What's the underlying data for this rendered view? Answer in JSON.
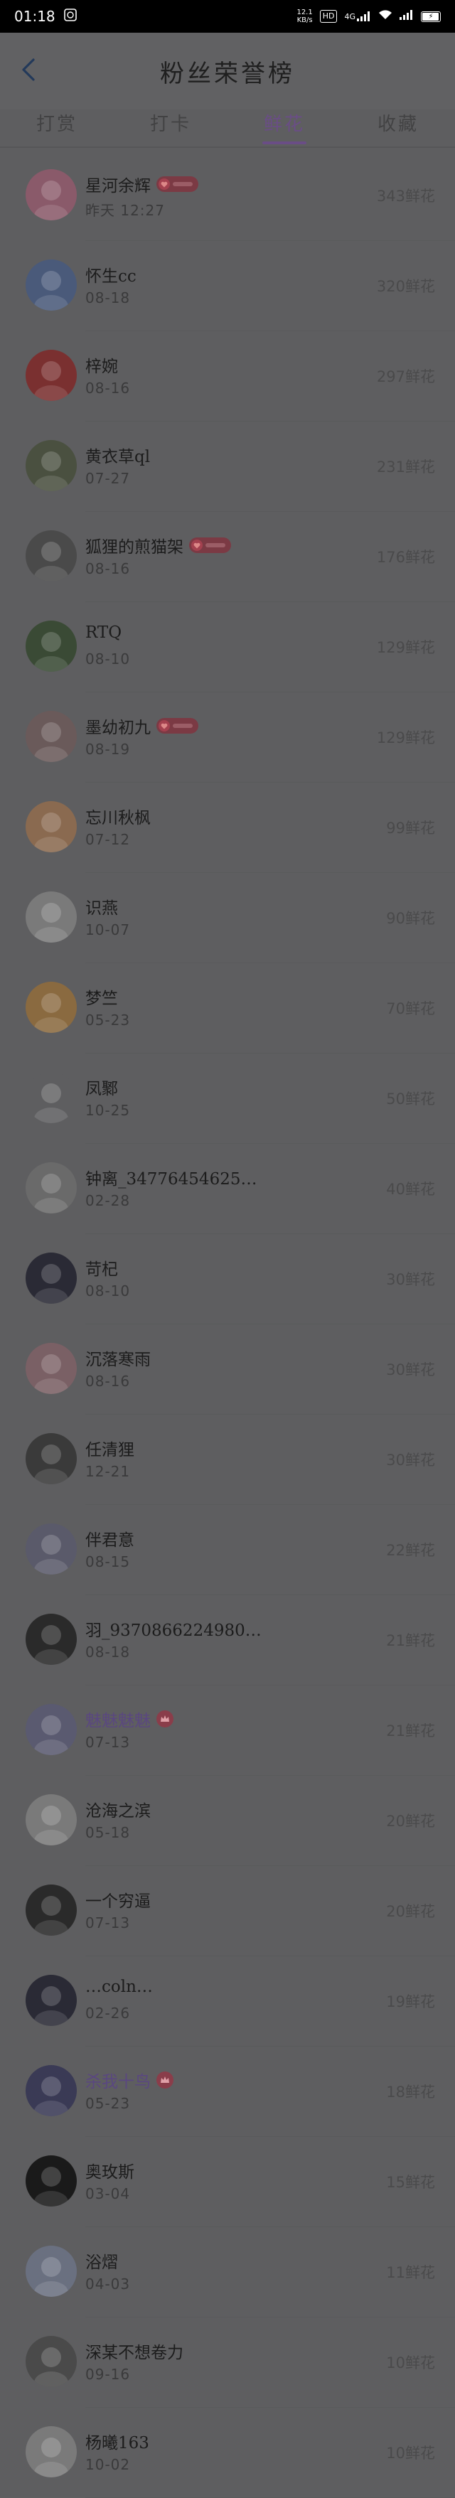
{
  "status_bar": {
    "time": "01:18",
    "net_speed": "12.1",
    "net_speed_unit": "KB/s",
    "hd_label": "HD",
    "signal_label": "4G",
    "colors": {
      "background": "#000000",
      "text": "#ffffff"
    }
  },
  "header": {
    "title": "粉丝荣誉榜",
    "back_icon": "chevron-left-icon"
  },
  "tabs": [
    {
      "label": "打赏",
      "active": false
    },
    {
      "label": "打卡",
      "active": false
    },
    {
      "label": "鲜花",
      "active": true
    },
    {
      "label": "收藏",
      "active": false
    }
  ],
  "colors": {
    "background": "#5e5e60",
    "active_tab": "#6a4d86",
    "name_text": "#1c1c1c",
    "vip_name_text": "#5a4780",
    "badge": "#7b3a44"
  },
  "ranking": [
    {
      "name": "星河余辉",
      "date": "昨天 12:27",
      "amount": "343鲜花",
      "badge": "level",
      "avatar_color": "#8a5a6a"
    },
    {
      "name": "怀生cc",
      "date": "08-18",
      "amount": "320鲜花",
      "badge": "",
      "avatar_color": "#4a5a7a"
    },
    {
      "name": "梓婉",
      "date": "08-16",
      "amount": "297鲜花",
      "badge": "",
      "avatar_color": "#7a3030"
    },
    {
      "name": "黄衣草ql",
      "date": "07-27",
      "amount": "231鲜花",
      "badge": "",
      "avatar_color": "#4a5040"
    },
    {
      "name": "狐狸的煎猫架",
      "date": "08-16",
      "amount": "176鲜花",
      "badge": "level",
      "avatar_color": "#4a4a4a"
    },
    {
      "name": "RTQ",
      "date": "08-10",
      "amount": "129鲜花",
      "badge": "",
      "avatar_color": "#3a4a35"
    },
    {
      "name": "墨幼初九",
      "date": "08-19",
      "amount": "129鲜花",
      "badge": "level",
      "avatar_color": "#6a5a5a"
    },
    {
      "name": "忘川秋枫",
      "date": "07-12",
      "amount": "99鲜花",
      "badge": "",
      "avatar_color": "#8a6a50"
    },
    {
      "name": "识燕",
      "date": "10-07",
      "amount": "90鲜花",
      "badge": "",
      "avatar_color": "#7a7a7a"
    },
    {
      "name": "梦竺",
      "date": "05-23",
      "amount": "70鲜花",
      "badge": "",
      "avatar_color": "#8a6a40"
    },
    {
      "name": "凤鄹",
      "date": "10-25",
      "amount": "50鲜花",
      "badge": "",
      "avatar_color": "#5e5e60"
    },
    {
      "name": "钟离_34776454625…",
      "date": "02-28",
      "amount": "40鲜花",
      "badge": "",
      "avatar_color": "#6a6a6a"
    },
    {
      "name": "苛杞",
      "date": "08-10",
      "amount": "30鲜花",
      "badge": "",
      "avatar_color": "#2a2a35"
    },
    {
      "name": "沉落寒雨",
      "date": "08-16",
      "amount": "30鲜花",
      "badge": "",
      "avatar_color": "#7a6065"
    },
    {
      "name": "任清狸",
      "date": "12-21",
      "amount": "30鲜花",
      "badge": "",
      "avatar_color": "#3a3a3a"
    },
    {
      "name": "伴君意",
      "date": "08-15",
      "amount": "22鲜花",
      "badge": "",
      "avatar_color": "#5a5a6a"
    },
    {
      "name": "羽_9370866224980…",
      "date": "08-18",
      "amount": "21鲜花",
      "badge": "",
      "avatar_color": "#2a2a2a"
    },
    {
      "name": "魅魅魅魅",
      "date": "07-13",
      "amount": "21鲜花",
      "badge": "vip",
      "avatar_color": "#5a5a70"
    },
    {
      "name": "沧海之滨",
      "date": "05-18",
      "amount": "20鲜花",
      "badge": "",
      "avatar_color": "#7a7a7a"
    },
    {
      "name": "一个穷逼",
      "date": "07-13",
      "amount": "20鲜花",
      "badge": "",
      "avatar_color": "#2a2a2a"
    },
    {
      "name": "…coln…",
      "date": "02-26",
      "amount": "19鲜花",
      "badge": "",
      "avatar_color": "#2a2a35"
    },
    {
      "name": "杀我十鸟",
      "date": "05-23",
      "amount": "18鲜花",
      "badge": "vip",
      "avatar_color": "#3a3a55"
    },
    {
      "name": "奥玫斯",
      "date": "03-04",
      "amount": "15鲜花",
      "badge": "",
      "avatar_color": "#1a1a1a"
    },
    {
      "name": "浴熠",
      "date": "04-03",
      "amount": "11鲜花",
      "badge": "",
      "avatar_color": "#6a7080"
    },
    {
      "name": "深某不想卷力",
      "date": "09-16",
      "amount": "10鲜花",
      "badge": "",
      "avatar_color": "#4a4a4a"
    },
    {
      "name": "杨曦163",
      "date": "10-02",
      "amount": "10鲜花",
      "badge": "",
      "avatar_color": "#7a7a7a"
    }
  ]
}
